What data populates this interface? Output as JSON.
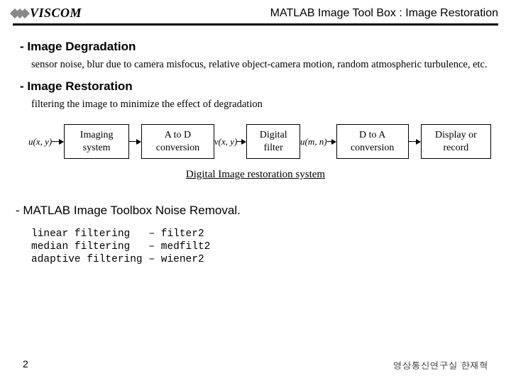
{
  "header": {
    "logo_text": "VISCOM",
    "title": "MATLAB Image Tool Box : Image Restoration"
  },
  "section1": {
    "heading": "- Image Degradation",
    "body": "sensor noise, blur due to camera misfocus, relative object-camera motion, random atmospheric turbulence, etc."
  },
  "section2": {
    "heading": "- Image Restoration",
    "body": "filtering the image to minimize the effect of degradation"
  },
  "flow": {
    "in_label": "u(x, y)",
    "boxes": [
      "Imaging\nsystem",
      "A to D\nconversion",
      "Digital\nfilter",
      "D to A\nconversion",
      "Display or\nrecord"
    ],
    "mid1": "v(x, y)",
    "mid2": "u(m, n)",
    "caption": "Digital Image restoration system"
  },
  "section3": {
    "heading": "- MATLAB Image Toolbox Noise Removal.",
    "rows": [
      [
        "linear filtering",
        "– filter2"
      ],
      [
        "median filtering",
        "– medfilt2"
      ],
      [
        "adaptive filtering",
        "– wiener2"
      ]
    ]
  },
  "footer": {
    "page": "2",
    "credit": "영상통신연구실 한재혁"
  }
}
